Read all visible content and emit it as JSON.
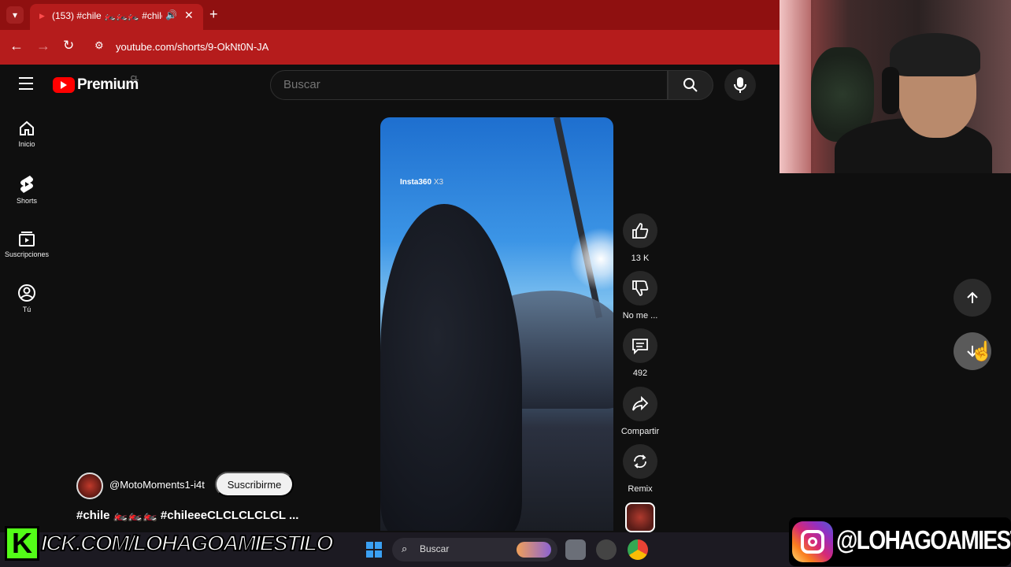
{
  "browser": {
    "tab": {
      "title": "(153) #chile 🏍️🏍️🏍️ #chile",
      "close_glyph": "✕"
    },
    "new_tab_glyph": "+",
    "url": "youtube.com/shorts/9-OkNt0N-JA"
  },
  "header": {
    "logo_text": "Premium",
    "region": "CL",
    "search_placeholder": "Buscar"
  },
  "sidebar": {
    "items": [
      {
        "label": "Inicio",
        "icon": "home-icon"
      },
      {
        "label": "Shorts",
        "icon": "shorts-icon"
      },
      {
        "label": "Suscripciones",
        "icon": "subscriptions-icon"
      },
      {
        "label": "Tú",
        "icon": "you-icon"
      }
    ]
  },
  "video": {
    "watermark_brand": "Insta360",
    "watermark_model": "X3"
  },
  "actions": {
    "like_count": "13 K",
    "dislike_label": "No me ...",
    "comments_count": "492",
    "share_label": "Compartir",
    "remix_label": "Remix"
  },
  "channel": {
    "handle": "@MotoMoments1-i4t",
    "subscribe_label": "Suscribirme"
  },
  "short_title": "#chile 🏍️🏍️🏍️ #chileeeCLCLCLCLCL ...",
  "taskbar": {
    "search_text": "Buscar"
  },
  "overlays": {
    "kick_text": "ICK.COM/LOHAGOAMIESTILO",
    "instagram_text": "@LOHAGOAMIESTILO"
  },
  "colors": {
    "chrome_red": "#b51c1c",
    "youtube_red": "#ff0000",
    "kick_green": "#53fc18"
  }
}
